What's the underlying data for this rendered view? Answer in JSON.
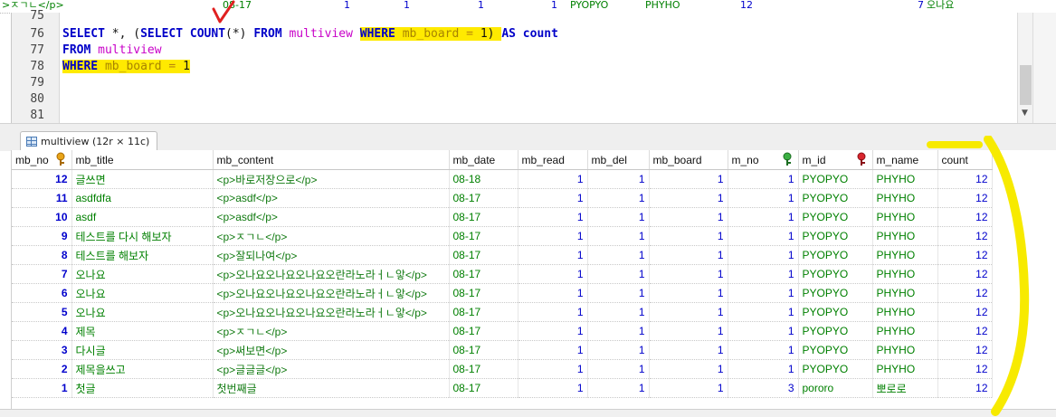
{
  "top_strip": {
    "c1": ">ㅈㄱㄴ</p>",
    "c2": "08-17",
    "c3": "1",
    "c4": "1",
    "c5": "1",
    "c6": "1",
    "c7": "PYOPYO",
    "c8": "PHYHO",
    "c9": "12",
    "right_num": "7",
    "right_text": "오나요"
  },
  "editor": {
    "lines": [
      {
        "num": "75"
      },
      {
        "num": "76",
        "t1": "SELECT",
        "t2": " *, (",
        "t3": "SELECT COUNT",
        "t4": "(*) ",
        "t5": "FROM",
        "t6": " multiview ",
        "t7": "WHERE",
        "t8": " mb_board",
        "t9": " = ",
        "t10": "1",
        "t11": ") ",
        "t12": "AS",
        "t13": " count"
      },
      {
        "num": "77",
        "t1": "FROM",
        "t2": " multiview"
      },
      {
        "num": "78",
        "t1": "WHERE",
        "t2": " mb_board",
        "t3": " = ",
        "t4": "1"
      },
      {
        "num": "79"
      },
      {
        "num": "80"
      },
      {
        "num": "81"
      }
    ]
  },
  "tab": {
    "label": "multiview (12r × 11c)"
  },
  "grid": {
    "columns": [
      "mb_no",
      "mb_title",
      "mb_content",
      "mb_date",
      "mb_read",
      "mb_del",
      "mb_board",
      "m_no",
      "m_id",
      "m_name",
      "count"
    ],
    "rows": [
      [
        "12",
        "글쓰면",
        "<p>바로저장으로</p>",
        "08-18",
        "1",
        "1",
        "1",
        "1",
        "PYOPYO",
        "PHYHO",
        "12"
      ],
      [
        "11",
        "asdfdfa",
        "<p>asdf</p>",
        "08-17",
        "1",
        "1",
        "1",
        "1",
        "PYOPYO",
        "PHYHO",
        "12"
      ],
      [
        "10",
        "asdf",
        "<p>asdf</p>",
        "08-17",
        "1",
        "1",
        "1",
        "1",
        "PYOPYO",
        "PHYHO",
        "12"
      ],
      [
        "9",
        "테스트를 다시 해보자",
        "<p>ㅈㄱㄴ</p>",
        "08-17",
        "1",
        "1",
        "1",
        "1",
        "PYOPYO",
        "PHYHO",
        "12"
      ],
      [
        "8",
        "테스트를 해보자",
        "<p>잘되나여</p>",
        "08-17",
        "1",
        "1",
        "1",
        "1",
        "PYOPYO",
        "PHYHO",
        "12"
      ],
      [
        "7",
        "오나요",
        "<p>오나요오나요오나요오란라노라ㅓㄴ앟</p>",
        "08-17",
        "1",
        "1",
        "1",
        "1",
        "PYOPYO",
        "PHYHO",
        "12"
      ],
      [
        "6",
        "오나요",
        "<p>오나요오나요오나요오란라노라ㅓㄴ앟</p>",
        "08-17",
        "1",
        "1",
        "1",
        "1",
        "PYOPYO",
        "PHYHO",
        "12"
      ],
      [
        "5",
        "오나요",
        "<p>오나요오나요오나요오란라노라ㅓㄴ앟</p>",
        "08-17",
        "1",
        "1",
        "1",
        "1",
        "PYOPYO",
        "PHYHO",
        "12"
      ],
      [
        "4",
        "제목",
        "<p>ㅈㄱㄴ</p>",
        "08-17",
        "1",
        "1",
        "1",
        "1",
        "PYOPYO",
        "PHYHO",
        "12"
      ],
      [
        "3",
        "다시글",
        "<p>써보면</p>",
        "08-17",
        "1",
        "1",
        "1",
        "1",
        "PYOPYO",
        "PHYHO",
        "12"
      ],
      [
        "2",
        "제목을쓰고",
        "<p>글글글</p>",
        "08-17",
        "1",
        "1",
        "1",
        "1",
        "PYOPYO",
        "PHYHO",
        "12"
      ],
      [
        "1",
        "첫글",
        "첫번째글",
        "08-17",
        "1",
        "1",
        "1",
        "3",
        "pororo",
        "뽀로로",
        "12"
      ]
    ]
  },
  "colors": {
    "highlight": "#ffea00",
    "keyword": "#0000c8",
    "table_name": "#c800c8",
    "column_name": "#a88400",
    "number_cell": "#0000cc",
    "text_cell": "#008000",
    "annotation_red": "#e02020",
    "annotation_yellow": "#f7ea00"
  },
  "icons": {
    "primary_key": "key-gold-icon",
    "foreign_key_green": "key-green-icon",
    "foreign_key_red": "key-red-icon",
    "tab": "grid-table-icon"
  }
}
